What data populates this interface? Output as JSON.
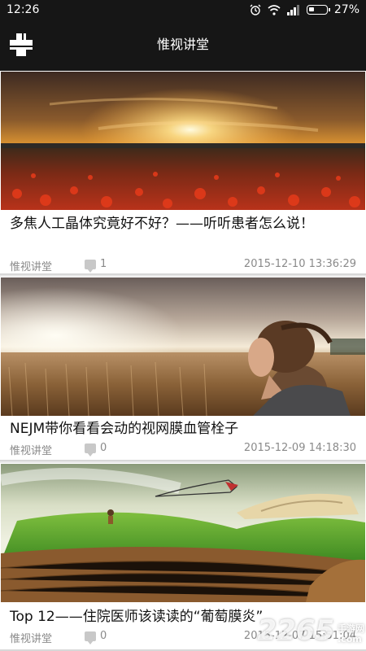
{
  "status_bar": {
    "time": "12:26",
    "battery": "27%"
  },
  "app_bar": {
    "title": "惟视讲堂",
    "menu_icon": "cross-menu-icon"
  },
  "articles": [
    {
      "image": "sunset-poppy-field",
      "title": "多焦人工晶体究竟好不好？——听听患者怎么说！",
      "source": "惟视讲堂",
      "comments": "1",
      "date": "2015-12-10 13:36:29"
    },
    {
      "image": "woman-in-wheat-field",
      "title": "NEJM带你看看会动的视网膜血管栓子",
      "source": "惟视讲堂",
      "comments": "0",
      "date": "2015-12-09 14:18:30"
    },
    {
      "image": "book-landscape-kite",
      "title": "Top 12——住院医师该读读的“葡萄膜炎”",
      "source": "惟视讲堂",
      "comments": "0",
      "date": "2015-12-07 15:51:04"
    }
  ],
  "watermark": {
    "logo": "2265",
    "line1": "手游网",
    "line2": ".com"
  }
}
